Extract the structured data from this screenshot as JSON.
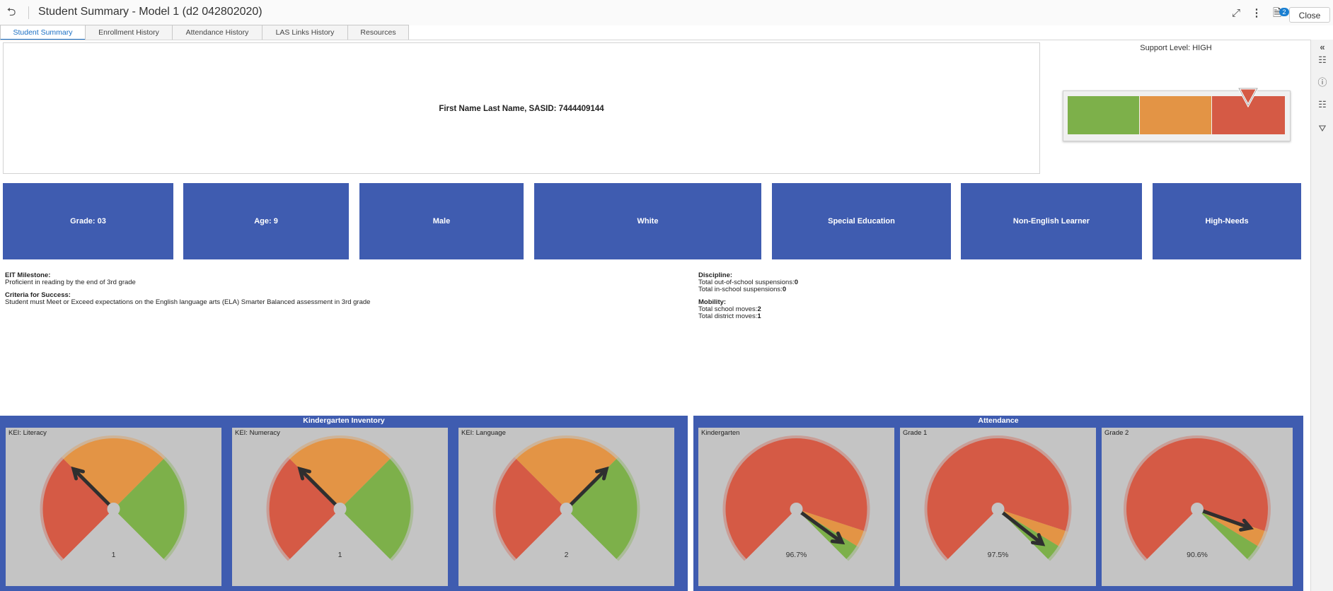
{
  "header": {
    "title": "Student Summary - Model 1 (d2 042802020)",
    "notification_count": "2",
    "close_label": "Close",
    "icons": [
      "back-icon",
      "fullscreen-icon",
      "more-icon",
      "notes-icon"
    ]
  },
  "tabs": [
    {
      "label": "Student Summary",
      "active": true
    },
    {
      "label": "Enrollment History",
      "active": false
    },
    {
      "label": "Attendance History",
      "active": false
    },
    {
      "label": "LAS Links History",
      "active": false
    },
    {
      "label": "Resources",
      "active": false
    }
  ],
  "rail": {
    "icons": [
      "collapse-icon",
      "data-icon",
      "info-icon",
      "comment-icon",
      "filter-icon"
    ]
  },
  "student": {
    "name_line": "First Name Last Name, SASID: 7444409144"
  },
  "support": {
    "label": "Support Level: HIGH",
    "level": "HIGH",
    "colors": {
      "low": "#7db04a",
      "medium": "#e39445",
      "high": "#d55a45"
    }
  },
  "tiles": [
    {
      "label": "Grade: 03"
    },
    {
      "label": "Age: 9"
    },
    {
      "label": "Male"
    },
    {
      "label": "White"
    },
    {
      "label": "Special Education"
    },
    {
      "label": "Non-English Learner"
    },
    {
      "label": "High-Needs"
    }
  ],
  "milestone": {
    "eit_label": "EIT Milestone:",
    "eit_text": "Proficient in reading by the end of 3rd grade",
    "criteria_label": "Criteria for Success:",
    "criteria_text": "Student must Meet or Exceed expectations on the English language arts (ELA) Smarter Balanced assessment in 3rd grade"
  },
  "discipline": {
    "label": "Discipline:",
    "oss_label": "Total out-of-school suspensions:",
    "oss_value": "0",
    "iss_label": "Total in-school suspensions:",
    "iss_value": "0"
  },
  "mobility": {
    "label": "Mobility:",
    "school_label": "Total school moves:",
    "school_value": "2",
    "district_label": "Total district moves:",
    "district_value": "1"
  },
  "chart_data": [
    {
      "type": "gauge",
      "title": "Kindergarten Inventory",
      "gauges": [
        {
          "label": "KEI: Literacy",
          "value": 1,
          "display": "1",
          "range": [
            0,
            3
          ],
          "bands": [
            {
              "from": 0,
              "to": 1,
              "color": "#d55a45"
            },
            {
              "from": 1,
              "to": 2,
              "color": "#e39445"
            },
            {
              "from": 2,
              "to": 3,
              "color": "#7db04a"
            }
          ]
        },
        {
          "label": "KEI: Numeracy",
          "value": 1,
          "display": "1",
          "range": [
            0,
            3
          ],
          "bands": [
            {
              "from": 0,
              "to": 1,
              "color": "#d55a45"
            },
            {
              "from": 1,
              "to": 2,
              "color": "#e39445"
            },
            {
              "from": 2,
              "to": 3,
              "color": "#7db04a"
            }
          ]
        },
        {
          "label": "KEI: Language",
          "value": 2,
          "display": "2",
          "range": [
            0,
            3
          ],
          "bands": [
            {
              "from": 0,
              "to": 1,
              "color": "#d55a45"
            },
            {
              "from": 1,
              "to": 2,
              "color": "#e39445"
            },
            {
              "from": 2,
              "to": 3,
              "color": "#7db04a"
            }
          ]
        }
      ]
    },
    {
      "type": "gauge",
      "title": "Attendance",
      "gauges": [
        {
          "label": "Kindergarten",
          "value": 96.7,
          "display": "96.7%",
          "range": [
            0,
            100
          ],
          "bands": [
            {
              "from": 0,
              "to": 90,
              "color": "#d55a45"
            },
            {
              "from": 90,
              "to": 95,
              "color": "#e39445"
            },
            {
              "from": 95,
              "to": 100,
              "color": "#7db04a"
            }
          ]
        },
        {
          "label": "Grade 1",
          "value": 97.5,
          "display": "97.5%",
          "range": [
            0,
            100
          ],
          "bands": [
            {
              "from": 0,
              "to": 90,
              "color": "#d55a45"
            },
            {
              "from": 90,
              "to": 95,
              "color": "#e39445"
            },
            {
              "from": 95,
              "to": 100,
              "color": "#7db04a"
            }
          ]
        },
        {
          "label": "Grade 2",
          "value": 90.6,
          "display": "90.6%",
          "range": [
            0,
            100
          ],
          "bands": [
            {
              "from": 0,
              "to": 90,
              "color": "#d55a45"
            },
            {
              "from": 90,
              "to": 95,
              "color": "#e39445"
            },
            {
              "from": 95,
              "to": 100,
              "color": "#7db04a"
            }
          ]
        }
      ]
    }
  ]
}
